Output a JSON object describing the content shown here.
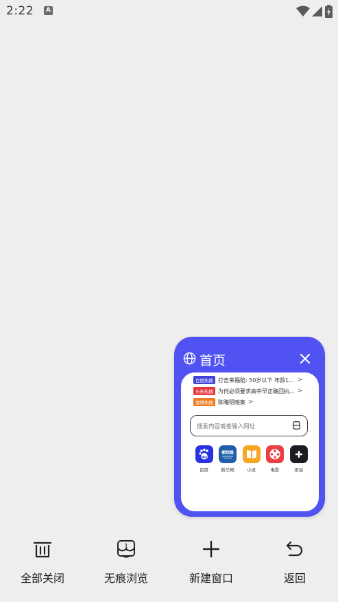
{
  "status_bar": {
    "time": "2:22",
    "notification_icon": "A"
  },
  "tab": {
    "title": "首页",
    "news": [
      {
        "tag": "百度热搜",
        "tag_color": "#3d42d8",
        "text": "打击来福陷: 50岁以下 年龄10..."
      },
      {
        "tag": "头条热搜",
        "tag_color": "#e8343b",
        "text": "为何必须要求高中早正确回执..."
      },
      {
        "tag": "微博热搜",
        "tag_color": "#f07b1e",
        "text": "陈曦明暗案"
      }
    ],
    "search_placeholder": "搜索内容或者输入网址",
    "shortcuts": [
      {
        "label": "百度",
        "icon": "baidu-icon",
        "color": "#2932e1",
        "glyph": "du"
      },
      {
        "label": "新华网",
        "icon": "xinhua-icon",
        "color": "#1f5ea8",
        "glyph": "新华"
      },
      {
        "label": "小说",
        "icon": "book-icon",
        "color": "#f5a623",
        "glyph": "▮▮"
      },
      {
        "label": "电影",
        "icon": "film-icon",
        "color": "#ec3e45",
        "glyph": "●"
      },
      {
        "label": "添加",
        "icon": "add-icon",
        "color": "#1c1c24",
        "glyph": "+"
      }
    ]
  },
  "toolbar": {
    "close_all": "全部关闭",
    "incognito": "无痕浏览",
    "new_window": "新建窗口",
    "back": "返回"
  },
  "colors": {
    "accent": "#5152f2",
    "background": "#efeeef"
  }
}
